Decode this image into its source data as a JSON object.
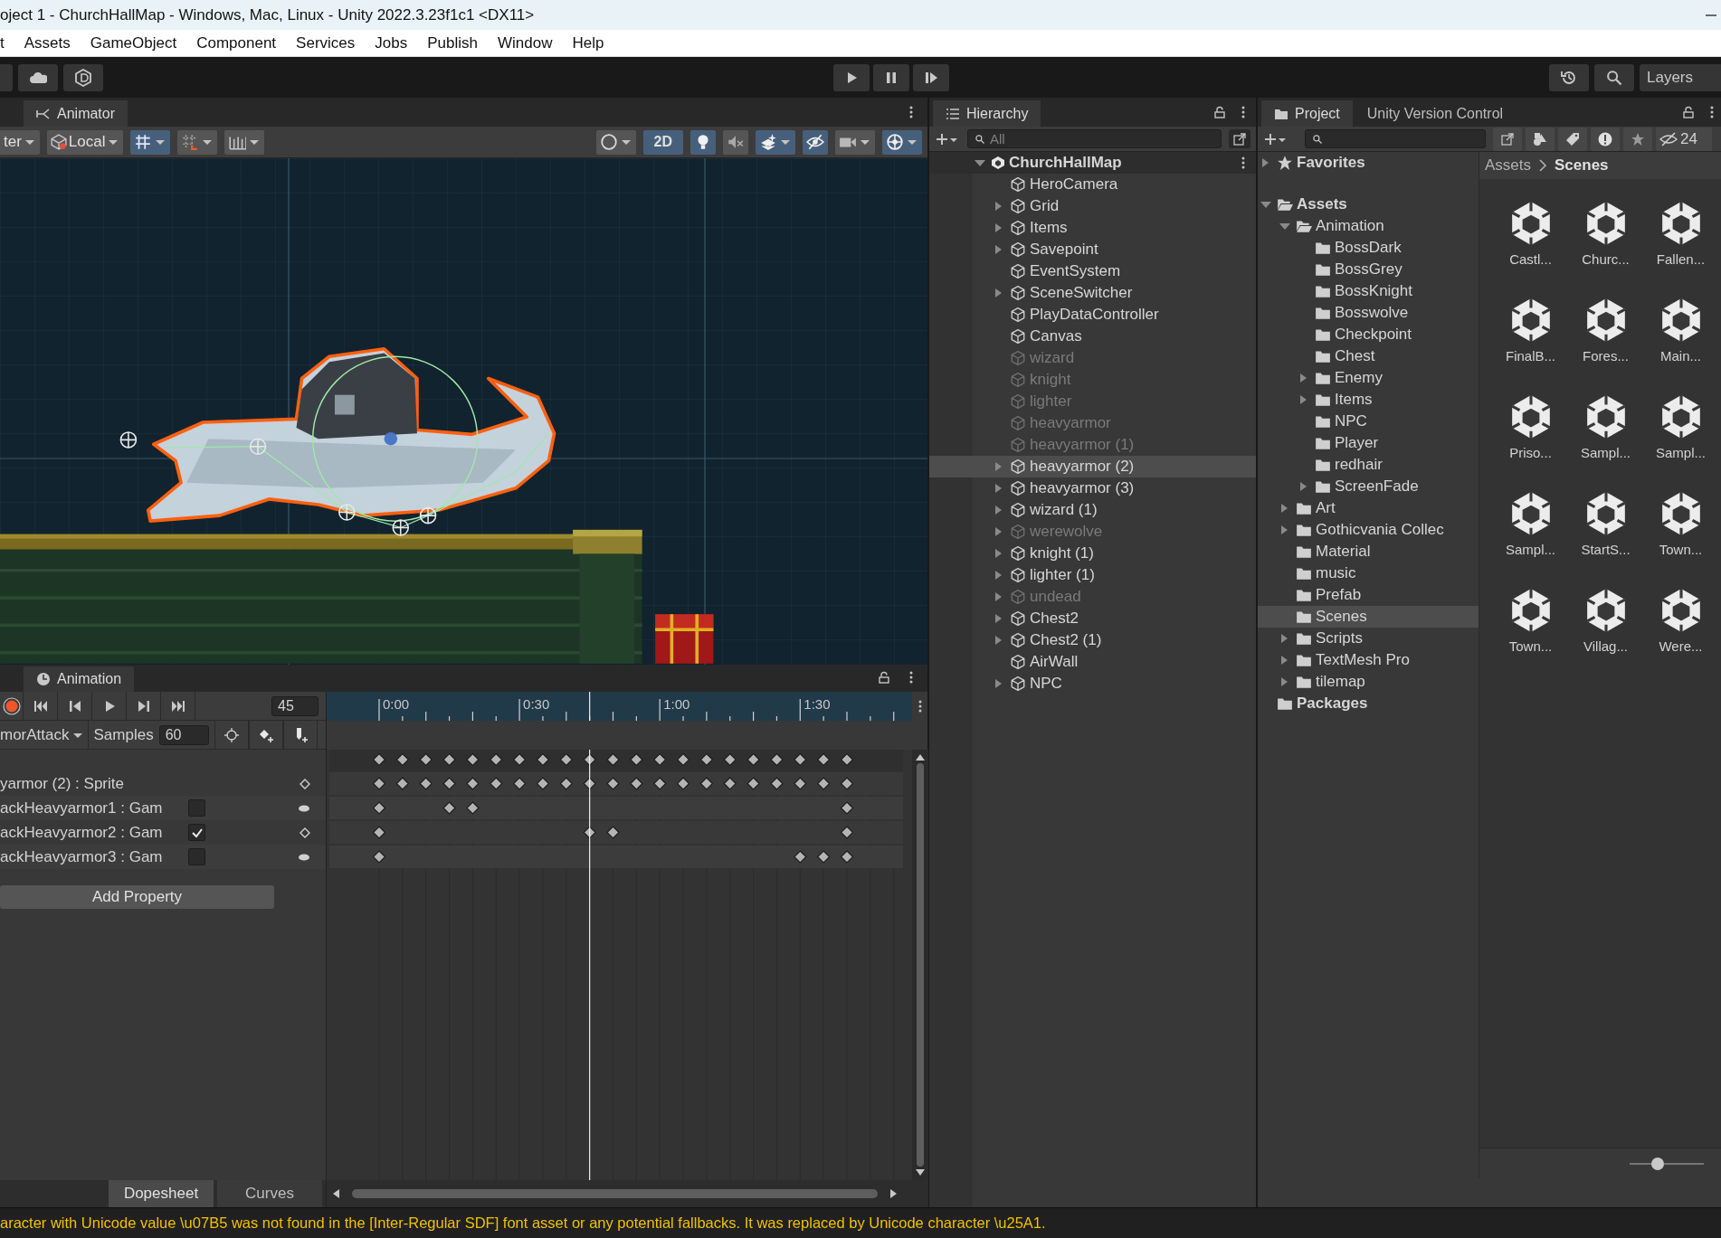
{
  "window": {
    "title": "oject 1 - ChurchHallMap - Windows, Mac, Linux - Unity 2022.3.23f1c1 <DX11>"
  },
  "menu": [
    "t",
    "Assets",
    "GameObject",
    "Component",
    "Services",
    "Jobs",
    "Publish",
    "Window",
    "Help"
  ],
  "toolbar": {
    "layers": "Layers"
  },
  "animator_tab": {
    "label": "Animator"
  },
  "scene_toolbar": {
    "tools": [
      {
        "kind": "pivot",
        "label": "ter",
        "on": false
      },
      {
        "kind": "space",
        "label": "Local",
        "on": false
      },
      {
        "kind": "grid-snap",
        "on": true
      },
      {
        "kind": "increment-snap",
        "on": false
      },
      {
        "kind": "grid-ruler",
        "on": false
      },
      {
        "kind": "shading",
        "on": false
      },
      {
        "kind": "mode-2d",
        "label": "2D",
        "on": true
      },
      {
        "kind": "lighting",
        "on": true
      },
      {
        "kind": "audio",
        "on": false
      },
      {
        "kind": "effects",
        "on": true
      },
      {
        "kind": "visibility",
        "on": true
      },
      {
        "kind": "camera",
        "on": false
      },
      {
        "kind": "gizmos",
        "on": true
      }
    ]
  },
  "animation": {
    "tab": "Animation",
    "frame": "45",
    "clip": "morAttack",
    "samples_label": "Samples",
    "samples": "60",
    "ticks": [
      "0:00",
      "0:30",
      "1:00",
      "1:30"
    ],
    "tracks": [
      {
        "kind": "sprite",
        "label": "yarmor (2) : Sprite",
        "keys": [
          {
            "level": 0
          },
          {
            "level": 0.05
          },
          {
            "level": 0.1
          },
          {
            "level": 0.15
          },
          {
            "level": 0.2
          },
          {
            "level": 0.25
          },
          {
            "level": 0.3
          },
          {
            "level": 0.35
          },
          {
            "level": 0.4
          },
          {
            "level": 0.45
          },
          {
            "level": 0.5
          },
          {
            "level": 0.55
          },
          {
            "level": 0.6
          },
          {
            "level": 0.65
          },
          {
            "level": 0.7
          },
          {
            "level": 0.75
          },
          {
            "level": 0.8
          },
          {
            "level": 0.85
          },
          {
            "level": 0.9
          },
          {
            "level": 0.95
          },
          {
            "level": 1
          }
        ]
      },
      {
        "kind": "active",
        "label": "ackHeavyarmor1 : Gam",
        "checked": false,
        "keys": [
          {
            "level": 0
          },
          {
            "level": 0.15
          },
          {
            "level": 0.2
          },
          {
            "level": 1
          }
        ]
      },
      {
        "kind": "active",
        "label": "ackHeavyarmor2 : Gam",
        "checked": true,
        "keys": [
          {
            "level": 0
          },
          {
            "level": 0.45
          },
          {
            "level": 0.5
          },
          {
            "level": 1
          }
        ]
      },
      {
        "kind": "active",
        "label": "ackHeavyarmor3 : Gam",
        "checked": false,
        "keys": [
          {
            "level": 0
          },
          {
            "level": 0.9
          },
          {
            "level": 0.95
          },
          {
            "level": 1
          }
        ]
      }
    ],
    "add_property": "Add Property",
    "views": [
      {
        "label": "Dopesheet",
        "selected": true
      },
      {
        "label": "Curves",
        "selected": false
      }
    ]
  },
  "hierarchy": {
    "tab": "Hierarchy",
    "search_placeholder": "All",
    "scene": {
      "label": "ChurchHallMap",
      "expanded": true,
      "children": [
        {
          "label": "HeroCamera",
          "expandable": false,
          "disabled": false,
          "selected": false
        },
        {
          "label": "Grid",
          "expandable": true,
          "disabled": false,
          "selected": false
        },
        {
          "label": "Items",
          "expandable": true,
          "disabled": false,
          "selected": false
        },
        {
          "label": "Savepoint",
          "expandable": true,
          "disabled": false,
          "selected": false
        },
        {
          "label": "EventSystem",
          "expandable": false,
          "disabled": false,
          "selected": false
        },
        {
          "label": "SceneSwitcher",
          "expandable": true,
          "disabled": false,
          "selected": false
        },
        {
          "label": "PlayDataController",
          "expandable": false,
          "disabled": false,
          "selected": false
        },
        {
          "label": "Canvas",
          "expandable": false,
          "disabled": false,
          "selected": false
        },
        {
          "label": "wizard",
          "expandable": false,
          "disabled": true,
          "selected": false
        },
        {
          "label": "knight",
          "expandable": false,
          "disabled": true,
          "selected": false
        },
        {
          "label": "lighter",
          "expandable": false,
          "disabled": true,
          "selected": false
        },
        {
          "label": "heavyarmor",
          "expandable": false,
          "disabled": true,
          "selected": false
        },
        {
          "label": "heavyarmor (1)",
          "expandable": false,
          "disabled": true,
          "selected": false
        },
        {
          "label": "heavyarmor (2)",
          "expandable": true,
          "disabled": false,
          "selected": true
        },
        {
          "label": "heavyarmor (3)",
          "expandable": true,
          "disabled": false,
          "selected": false
        },
        {
          "label": "wizard (1)",
          "expandable": true,
          "disabled": false,
          "selected": false
        },
        {
          "label": "werewolve",
          "expandable": true,
          "disabled": true,
          "selected": false
        },
        {
          "label": "knight (1)",
          "expandable": true,
          "disabled": false,
          "selected": false
        },
        {
          "label": "lighter (1)",
          "expandable": true,
          "disabled": false,
          "selected": false
        },
        {
          "label": "undead",
          "expandable": true,
          "disabled": true,
          "selected": false
        },
        {
          "label": "Chest2",
          "expandable": true,
          "disabled": false,
          "selected": false
        },
        {
          "label": "Chest2 (1)",
          "expandable": true,
          "disabled": false,
          "selected": false
        },
        {
          "label": "AirWall",
          "expandable": false,
          "disabled": false,
          "selected": false
        },
        {
          "label": "NPC",
          "expandable": true,
          "disabled": false,
          "selected": false
        }
      ]
    }
  },
  "project": {
    "tabs": [
      {
        "label": "Project",
        "selected": true
      },
      {
        "label": "Unity Version Control",
        "selected": false
      }
    ],
    "hidden_count": "24",
    "tree": [
      {
        "kind": "favorites",
        "label": "Favorites",
        "expandable": true,
        "expanded": false,
        "selected": false
      },
      {
        "kind": "root",
        "label": "Assets",
        "expandable": true,
        "expanded": true,
        "selected": false,
        "children": [
          {
            "label": "Animation",
            "expandable": true,
            "expanded": true,
            "selected": false,
            "children": [
              {
                "label": "BossDark",
                "expandable": false,
                "expanded": false,
                "selected": false
              },
              {
                "label": "BossGrey",
                "expandable": false,
                "expanded": false,
                "selected": false
              },
              {
                "label": "BossKnight",
                "expandable": false,
                "expanded": false,
                "selected": false
              },
              {
                "label": "Bosswolve",
                "expandable": false,
                "expanded": false,
                "selected": false
              },
              {
                "label": "Checkpoint",
                "expandable": false,
                "expanded": false,
                "selected": false
              },
              {
                "label": "Chest",
                "expandable": false,
                "expanded": false,
                "selected": false
              },
              {
                "label": "Enemy",
                "expandable": true,
                "expanded": false,
                "selected": false
              },
              {
                "label": "Items",
                "expandable": true,
                "expanded": false,
                "selected": false
              },
              {
                "label": "NPC",
                "expandable": false,
                "expanded": false,
                "selected": false
              },
              {
                "label": "Player",
                "expandable": false,
                "expanded": false,
                "selected": false
              },
              {
                "label": "redhair",
                "expandable": false,
                "expanded": false,
                "selected": false
              },
              {
                "label": "ScreenFade",
                "expandable": true,
                "expanded": false,
                "selected": false
              }
            ]
          },
          {
            "label": "Art",
            "expandable": true,
            "expanded": false,
            "selected": false
          },
          {
            "label": "Gothicvania Collec",
            "expandable": true,
            "expanded": false,
            "selected": false
          },
          {
            "label": "Material",
            "expandable": false,
            "expanded": false,
            "selected": false
          },
          {
            "label": "music",
            "expandable": false,
            "expanded": false,
            "selected": false
          },
          {
            "label": "Prefab",
            "expandable": false,
            "expanded": false,
            "selected": false
          },
          {
            "label": "Scenes",
            "expandable": false,
            "expanded": false,
            "selected": true
          },
          {
            "label": "Scripts",
            "expandable": true,
            "expanded": false,
            "selected": false
          },
          {
            "label": "TextMesh Pro",
            "expandable": true,
            "expanded": false,
            "selected": false
          },
          {
            "label": "tilemap",
            "expandable": true,
            "expanded": false,
            "selected": false
          }
        ]
      },
      {
        "kind": "root",
        "label": "Packages",
        "expandable": false,
        "expanded": false,
        "selected": false
      }
    ],
    "breadcrumb": [
      "Assets",
      "Scenes"
    ],
    "assets": [
      {
        "label": "Castl..."
      },
      {
        "label": "Churc..."
      },
      {
        "label": "Fallen..."
      },
      {
        "label": "FinalB..."
      },
      {
        "label": "Fores..."
      },
      {
        "label": "Main..."
      },
      {
        "label": "Priso..."
      },
      {
        "label": "Sampl..."
      },
      {
        "label": "Sampl..."
      },
      {
        "label": "Sampl..."
      },
      {
        "label": "StartS..."
      },
      {
        "label": "Town..."
      },
      {
        "label": "Town..."
      },
      {
        "label": "Villag..."
      },
      {
        "label": "Were..."
      }
    ],
    "icon_size": {
      "level": 0.38
    }
  },
  "status": {
    "message": "aracter with Unicode value \\u07B5 was not found in the [Inter-Regular SDF] font asset or any potential fallbacks. It was replaced by Unicode character \\u25A1."
  }
}
